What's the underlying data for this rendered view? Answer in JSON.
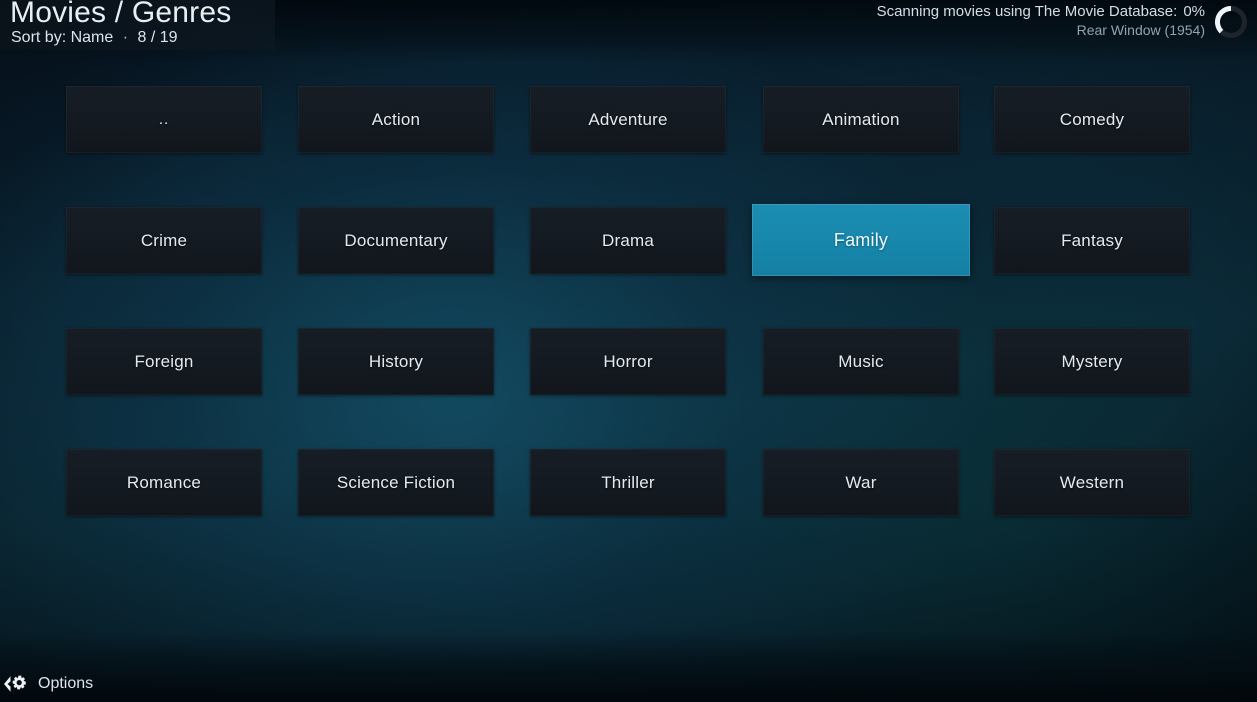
{
  "header": {
    "title": "Movies / Genres",
    "sort_label": "Sort by:",
    "sort_value": "Name",
    "separator": "·",
    "item_count": "8 / 19"
  },
  "scan": {
    "status_text": "Scanning movies using The Movie Database:",
    "percent": "0%",
    "current_item": "Rear Window (1954)",
    "spinner_icon": "loading-spinner-icon",
    "progress_value": 0
  },
  "grid": {
    "columns": 5,
    "rows": [
      [
        {
          "label": "..",
          "focused": false,
          "parent": true
        },
        {
          "label": "Action",
          "focused": false,
          "parent": false
        },
        {
          "label": "Adventure",
          "focused": false,
          "parent": false
        },
        {
          "label": "Animation",
          "focused": false,
          "parent": false
        },
        {
          "label": "Comedy",
          "focused": false,
          "parent": false
        }
      ],
      [
        {
          "label": "Crime",
          "focused": false,
          "parent": false
        },
        {
          "label": "Documentary",
          "focused": false,
          "parent": false
        },
        {
          "label": "Drama",
          "focused": false,
          "parent": false
        },
        {
          "label": "Family",
          "focused": true,
          "parent": false
        },
        {
          "label": "Fantasy",
          "focused": false,
          "parent": false
        }
      ],
      [
        {
          "label": "Foreign",
          "focused": false,
          "parent": false
        },
        {
          "label": "History",
          "focused": false,
          "parent": false
        },
        {
          "label": "Horror",
          "focused": false,
          "parent": false
        },
        {
          "label": "Music",
          "focused": false,
          "parent": false
        },
        {
          "label": "Mystery",
          "focused": false,
          "parent": false
        }
      ],
      [
        {
          "label": "Romance",
          "focused": false,
          "parent": false
        },
        {
          "label": "Science Fiction",
          "focused": false,
          "parent": false
        },
        {
          "label": "Thriller",
          "focused": false,
          "parent": false
        },
        {
          "label": "War",
          "focused": false,
          "parent": false
        },
        {
          "label": "Western",
          "focused": false,
          "parent": false
        }
      ]
    ]
  },
  "bottom_bar": {
    "options_label": "Options",
    "options_icon": "left-chevron-gear-icon"
  },
  "colors": {
    "focus_accent": "#1787ac",
    "tile_background": "#141a21",
    "text_primary": "#e3eaef",
    "text_secondary": "#93a3ae",
    "background_deep": "#0a2433"
  }
}
